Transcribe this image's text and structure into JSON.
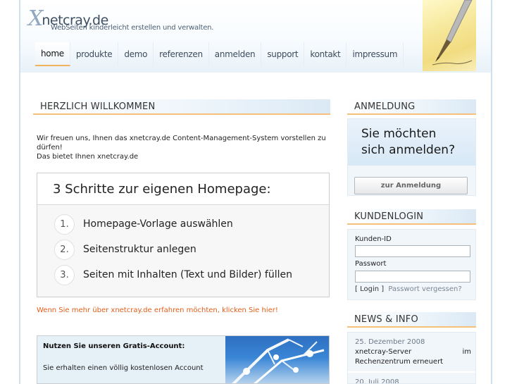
{
  "header": {
    "logo_x": "X",
    "logo_text": "netcray.de",
    "tagline": "WebSeiten kinderleicht erstellen und verwalten."
  },
  "nav": {
    "items": [
      {
        "label": "home",
        "active": true
      },
      {
        "label": "produkte"
      },
      {
        "label": "demo"
      },
      {
        "label": "referenzen"
      },
      {
        "label": "anmelden"
      },
      {
        "label": "support"
      },
      {
        "label": "kontakt"
      },
      {
        "label": "impressum"
      }
    ]
  },
  "main": {
    "welcome_title": "HERZLICH WILLKOMMEN",
    "intro_line1": "Wir freuen uns, Ihnen das xnetcray.de Content-Management-System vorstellen zu dürfen!",
    "intro_line2": "Das bietet Ihnen xnetcray.de",
    "steps_title": "3 Schritte zur eigenen Homepage:",
    "steps": [
      {
        "num": "1.",
        "text": "Homepage-Vorlage auswählen"
      },
      {
        "num": "2.",
        "text": "Seitenstruktur anlegen"
      },
      {
        "num": "3.",
        "text": "Seiten mit Inhalten (Text und Bilder) füllen"
      }
    ],
    "more_link": "Wenn Sie mehr über xnetcray.de erfahren möchten, klicken Sie hier!",
    "gratis_head": "Nutzen Sie unseren Gratis-Account:",
    "gratis_text": "Sie erhalten einen völlig kostenlosen Account"
  },
  "sidebar": {
    "anmeldung_title": "ANMELDUNG",
    "promo_line1": "Sie möchten",
    "promo_line2": "sich anmelden?",
    "promo_button": "zur Anmeldung",
    "kundenlogin_title": "KUNDENLOGIN",
    "kunden_id_label": "Kunden-ID",
    "passwort_label": "Passwort",
    "login_link": "[ Login ]",
    "forgot_link": "Passwort vergessen?",
    "news_title": "NEWS & INFO",
    "news": [
      {
        "date": "25. Dezember 2008",
        "line1": "xnetcray-Server",
        "line1b": "im",
        "line2": "Rechenzentrum erneuert"
      },
      {
        "date": "20. Juli 2008"
      }
    ]
  },
  "colors": {
    "accent_orange": "#f2b25b",
    "link_orange": "#e25d18",
    "sidebar_bg": "#f1f6fb"
  }
}
